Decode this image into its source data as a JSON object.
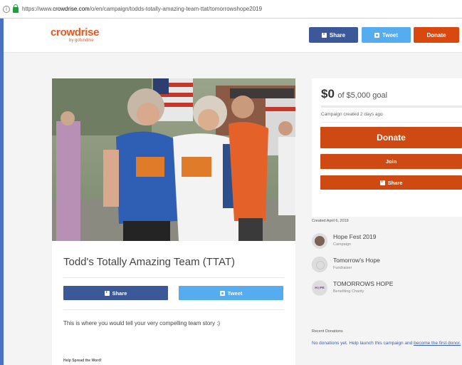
{
  "browser": {
    "url_prefix": "https://www.",
    "url_domain": "crowdrise.com",
    "url_path": "/o/en/campaign/todds-totally-amazing-team-ttat/tomorrowshope2019",
    "info_glyph": "i"
  },
  "header": {
    "logo_main": "crowdrise",
    "logo_sub": "by gofundme",
    "share_label": "Share",
    "tweet_label": "Tweet",
    "donate_label": "Donate"
  },
  "campaign": {
    "title": "Todd's Totally Amazing Team (TTAT)",
    "share_label": "Share",
    "tweet_label": "Tweet",
    "story": "This is where you would tell your very compelling team story :)",
    "spread_label": "Help Spread the Word!"
  },
  "sidebar": {
    "raised": "$0",
    "goal_text": "of $5,000 goal",
    "progress_fraction": 0,
    "created_text": "Campaign created 2 days ago",
    "donate_label": "Donate",
    "join_label": "Join",
    "share_label": "Share"
  },
  "info": {
    "created_on": "Created April 6, 2019",
    "items": [
      {
        "name": "Hope Fest 2019",
        "sub": "Campaign"
      },
      {
        "name": "Tomorrow's Hope",
        "sub": "Fundraiser"
      },
      {
        "name": "TOMORROWS HOPE",
        "sub": "Benefiting Charity",
        "badge": "H◎PE"
      }
    ],
    "recent_title": "Recent Donations",
    "no_donations": "No donations yet. Help launch this campaign and",
    "become_link": "become the first donor."
  },
  "colors": {
    "brand_orange": "#d9480f",
    "facebook": "#3b5998",
    "twitter": "#55acee"
  }
}
